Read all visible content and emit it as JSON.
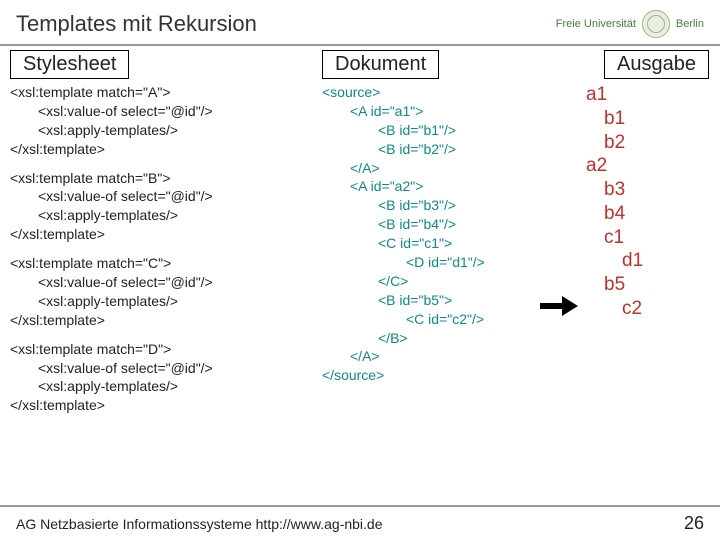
{
  "header": {
    "title": "Templates mit Rekursion",
    "logo_text": "Freie Universität",
    "logo_city": "Berlin"
  },
  "stylesheet": {
    "label": "Stylesheet",
    "blocks": [
      {
        "open": "<xsl:template match=\"A\">",
        "v": "<xsl:value-of select=\"@id\"/>",
        "a": "<xsl:apply-templates/>",
        "close": "</xsl:template>"
      },
      {
        "open": "<xsl:template match=\"B\">",
        "v": "<xsl:value-of select=\"@id\"/>",
        "a": "<xsl:apply-templates/>",
        "close": "</xsl:template>"
      },
      {
        "open": "<xsl:template match=\"C\">",
        "v": "<xsl:value-of select=\"@id\"/>",
        "a": "<xsl:apply-templates/>",
        "close": "</xsl:template>"
      },
      {
        "open": "<xsl:template match=\"D\">",
        "v": "<xsl:value-of select=\"@id\"/>",
        "a": "<xsl:apply-templates/>",
        "close": "</xsl:template>"
      }
    ]
  },
  "dokument": {
    "label": "Dokument",
    "lines": [
      {
        "t": "<source>",
        "cls": "teal"
      },
      {
        "t": "<A id=\"a1\">",
        "cls": "teal i1"
      },
      {
        "t": "<B id=\"b1\"/>",
        "cls": "teal i2"
      },
      {
        "t": "<B id=\"b2\"/>",
        "cls": "teal i2"
      },
      {
        "t": "</A>",
        "cls": "teal i1"
      },
      {
        "t": "<A id=\"a2\">",
        "cls": "teal i1"
      },
      {
        "t": "<B id=\"b3\"/>",
        "cls": "teal i2"
      },
      {
        "t": "<B id=\"b4\"/>",
        "cls": "teal i2"
      },
      {
        "t": "<C id=\"c1\">",
        "cls": "teal i2"
      },
      {
        "t": "<D id=\"d1\"/>",
        "cls": "teal i3"
      },
      {
        "t": "</C>",
        "cls": "teal i2"
      },
      {
        "t": "<B id=\"b5\">",
        "cls": "teal i2"
      },
      {
        "t": "<C id=\"c2\"/>",
        "cls": "teal i3"
      },
      {
        "t": "</B>",
        "cls": "teal i2"
      },
      {
        "t": "</A>",
        "cls": "teal i1"
      },
      {
        "t": "</source>",
        "cls": "teal"
      }
    ]
  },
  "ausgabe": {
    "label": "Ausgabe",
    "lines": [
      {
        "t": "a1",
        "cls": "o1"
      },
      {
        "t": "b1",
        "cls": "o2"
      },
      {
        "t": "b2",
        "cls": "o2"
      },
      {
        "t": "a2",
        "cls": "o1"
      },
      {
        "t": "b3",
        "cls": "o2"
      },
      {
        "t": "b4",
        "cls": "o2"
      },
      {
        "t": "c1",
        "cls": "o2"
      },
      {
        "t": "d1",
        "cls": "o3"
      },
      {
        "t": "b5",
        "cls": "o2"
      },
      {
        "t": "c2",
        "cls": "o3"
      }
    ]
  },
  "footer": {
    "left": "AG Netzbasierte Informationssysteme http://www.ag-nbi.de",
    "page": "26"
  }
}
